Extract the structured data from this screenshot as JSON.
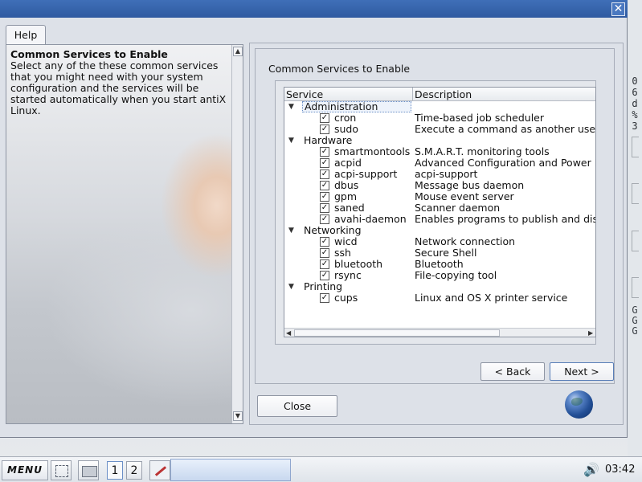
{
  "window": {
    "close_glyph": "✕"
  },
  "tabs": {
    "help": "Help"
  },
  "help": {
    "heading": "Common Services to Enable",
    "body": "Select any of the these common services that you might need with your system configuration and the services will be started automatically when you start antiX Linux."
  },
  "services": {
    "title": "Common Services to Enable",
    "columns": {
      "service": "Service",
      "description": "Description"
    },
    "categories": [
      {
        "name": "Administration",
        "items": [
          {
            "service": "cron",
            "description": "Time-based job scheduler",
            "checked": true
          },
          {
            "service": "sudo",
            "description": "Execute a command as another user",
            "checked": true
          }
        ]
      },
      {
        "name": "Hardware",
        "items": [
          {
            "service": "smartmontools",
            "description": "S.M.A.R.T. monitoring tools",
            "checked": true
          },
          {
            "service": "acpid",
            "description": "Advanced Configuration and Power Interface",
            "checked": true
          },
          {
            "service": "acpi-support",
            "description": "acpi-support",
            "checked": true
          },
          {
            "service": "dbus",
            "description": "Message bus daemon",
            "checked": true
          },
          {
            "service": "gpm",
            "description": "Mouse event server",
            "checked": true
          },
          {
            "service": "saned",
            "description": "Scanner daemon",
            "checked": true
          },
          {
            "service": "avahi-daemon",
            "description": "Enables programs to publish and discover",
            "checked": true
          }
        ]
      },
      {
        "name": "Networking",
        "items": [
          {
            "service": "wicd",
            "description": "Network connection",
            "checked": true
          },
          {
            "service": "ssh",
            "description": "Secure Shell",
            "checked": true
          },
          {
            "service": "bluetooth",
            "description": "Bluetooth",
            "checked": true
          },
          {
            "service": "rsync",
            "description": "File-copying tool",
            "checked": true
          }
        ]
      },
      {
        "name": "Printing",
        "items": [
          {
            "service": "cups",
            "description": "Linux and OS X printer service",
            "checked": true
          }
        ]
      }
    ]
  },
  "buttons": {
    "back": "< Back",
    "next": "Next >",
    "close": "Close"
  },
  "desktop": {
    "vertical_text": [
      "0",
      "6",
      "d",
      "%",
      "3"
    ],
    "vertical_text2": [
      "G",
      "G",
      "G"
    ]
  },
  "taskbar": {
    "menu": "MENU",
    "workspaces": [
      "1",
      "2"
    ],
    "speaker_glyph": "🔊",
    "clock": "03:42"
  },
  "glyphs": {
    "check": "✓",
    "expander": "▼",
    "up": "▲",
    "down": "▼",
    "left": "◀",
    "right": "▶"
  }
}
